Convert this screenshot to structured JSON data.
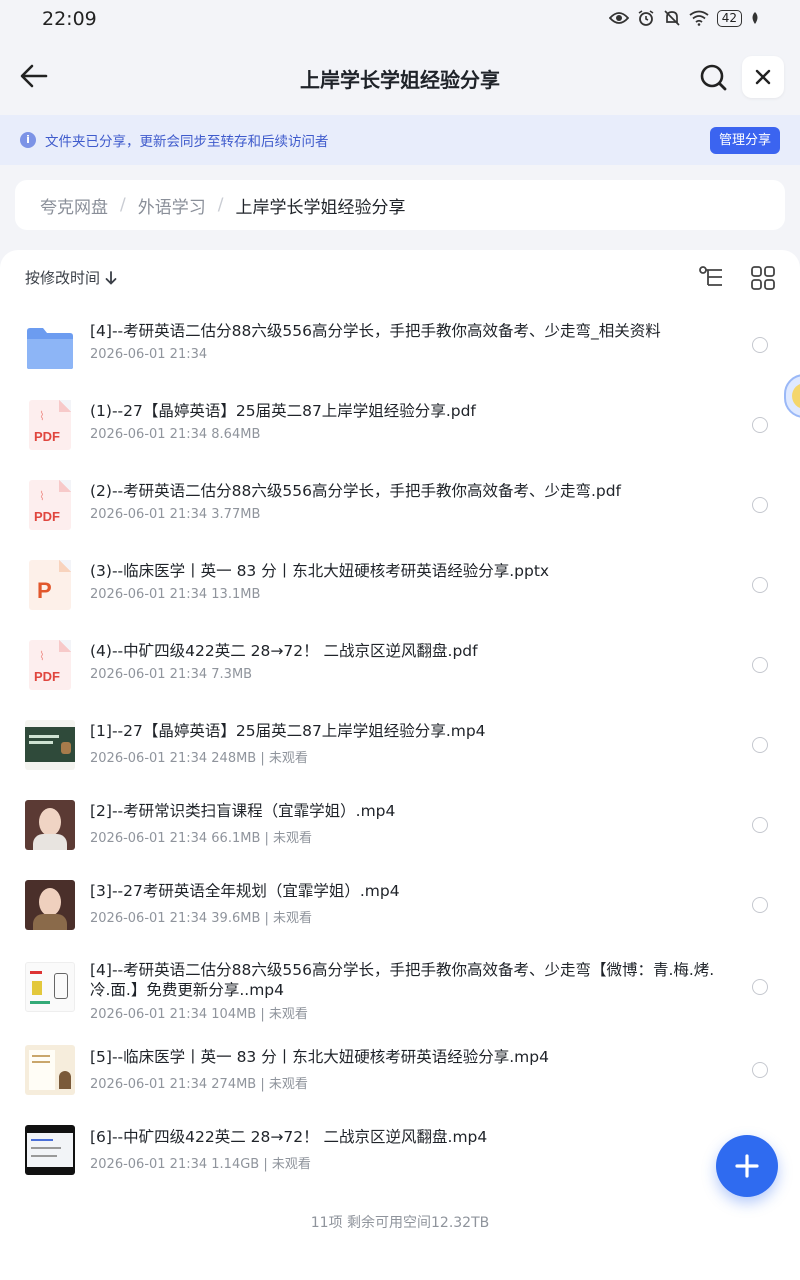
{
  "status": {
    "time": "22:09",
    "battery": "42"
  },
  "header": {
    "title": "上岸学长学姐经验分享"
  },
  "banner": {
    "text": "文件夹已分享，更新会同步至转存和后续访问者",
    "button": "管理分享"
  },
  "breadcrumb": {
    "items": [
      "夸克网盘",
      "外语学习",
      "上岸学长学姐经验分享"
    ]
  },
  "sort": {
    "label": "按修改时间"
  },
  "files": [
    {
      "type": "folder",
      "name": "[4]--考研英语二估分88六级556高分学长，手把手教你高效备考、少走弯_相关资料",
      "meta": "2026-06-01 21:34"
    },
    {
      "type": "pdf",
      "name": "(1)--27【晶婷英语】25届英二87上岸学姐经验分享.pdf",
      "meta": "2026-06-01 21:34  8.64MB"
    },
    {
      "type": "pdf",
      "name": "(2)--考研英语二估分88六级556高分学长，手把手教你高效备考、少走弯.pdf",
      "meta": "2026-06-01 21:34  3.77MB"
    },
    {
      "type": "ppt",
      "name": "(3)--临床医学丨英一 83 分丨东北大妞硬核考研英语经验分享.pptx",
      "meta": "2026-06-01 21:34  13.1MB"
    },
    {
      "type": "pdf",
      "name": "(4)--中矿四级422英二 28→72！ 二战京区逆风翻盘.pdf",
      "meta": "2026-06-01 21:34  7.3MB"
    },
    {
      "type": "video",
      "variant": "slide",
      "name": "[1]--27【晶婷英语】25届英二87上岸学姐经验分享.mp4",
      "meta": "2026-06-01 21:34  248MB | 未观看"
    },
    {
      "type": "video",
      "variant": "face",
      "name": "[2]--考研常识类扫盲课程（宜霏学姐）.mp4",
      "meta": "2026-06-01 21:34  66.1MB | 未观看"
    },
    {
      "type": "video",
      "variant": "face",
      "name": "[3]--27考研英语全年规划（宜霏学姐）.mp4",
      "meta": "2026-06-01 21:34  39.6MB | 未观看"
    },
    {
      "type": "video",
      "variant": "doc",
      "name": "[4]--考研英语二估分88六级556高分学长，手把手教你高效备考、少走弯【微博：青.梅.烤.冷.面.】免费更新分享..mp4",
      "meta": "2026-06-01 21:34  104MB | 未观看"
    },
    {
      "type": "video",
      "variant": "paper",
      "name": "[5]--临床医学丨英一 83 分丨东北大妞硬核考研英语经验分享.mp4",
      "meta": "2026-06-01 21:34  274MB | 未观看"
    },
    {
      "type": "video",
      "variant": "screen",
      "name": "[6]--中矿四级422英二 28→72！ 二战京区逆风翻盘.mp4",
      "meta": "2026-06-01 21:34  1.14GB | 未观看"
    }
  ],
  "footer": {
    "text": "11项 剩余可用空间12.32TB"
  },
  "icons": {
    "status": [
      "eye-icon",
      "alarm-icon",
      "mute-icon",
      "wifi-icon",
      "battery-icon",
      "leaf-icon"
    ],
    "toolbar": [
      "back-arrow-icon",
      "search-icon",
      "close-icon",
      "tree-view-icon",
      "grid-view-icon",
      "plus-icon"
    ]
  },
  "colors": {
    "accent": "#3b64f0",
    "banner_bg": "#e8edfb",
    "pdf_red": "#e0463e",
    "folder_blue": "#6c9cf0"
  }
}
